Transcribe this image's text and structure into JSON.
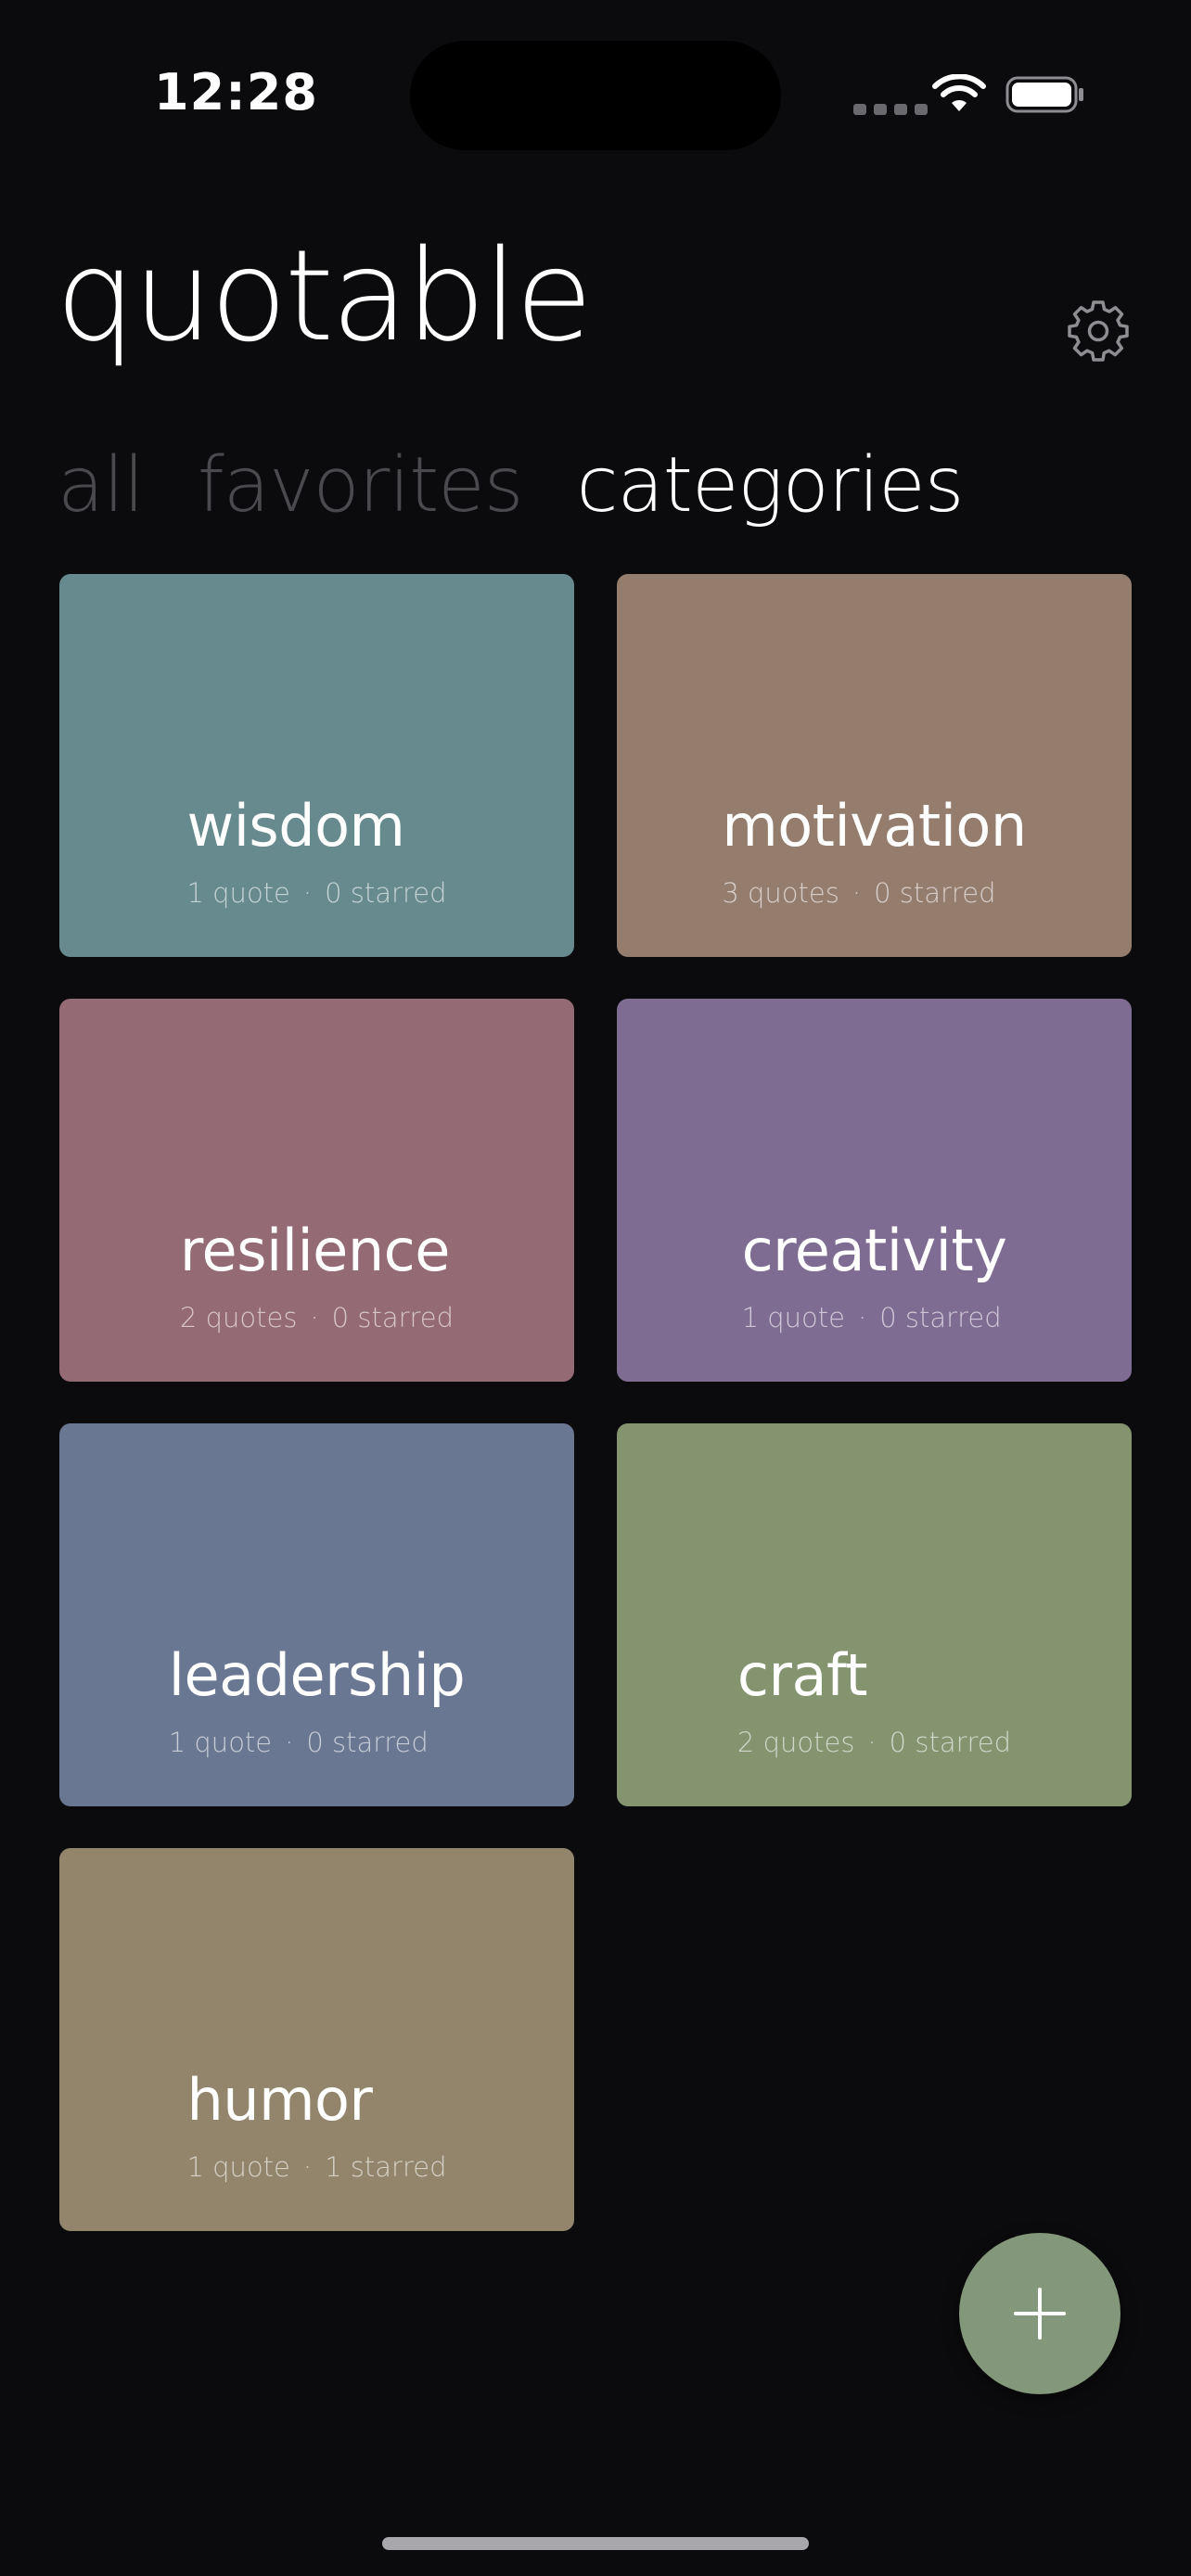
{
  "status_bar": {
    "time": "12:28"
  },
  "header": {
    "title": "quotable",
    "settings_icon": "gear-icon"
  },
  "tabs": [
    {
      "label": "all",
      "active": false
    },
    {
      "label": "favorites",
      "active": false
    },
    {
      "label": "categories",
      "active": true
    }
  ],
  "categories": [
    {
      "name": "wisdom",
      "quotes": "1 quote",
      "starred": "0 starred",
      "color": "#678a8e"
    },
    {
      "name": "motivation",
      "quotes": "3 quotes",
      "starred": "0 starred",
      "color": "#957d6e"
    },
    {
      "name": "resilience",
      "quotes": "2 quotes",
      "starred": "0 starred",
      "color": "#946a75"
    },
    {
      "name": "creativity",
      "quotes": "1 quote",
      "starred": "0 starred",
      "color": "#7f6c93"
    },
    {
      "name": "leadership",
      "quotes": "1 quote",
      "starred": "0 starred",
      "color": "#6a7792"
    },
    {
      "name": "craft",
      "quotes": "2 quotes",
      "starred": "0 starred",
      "color": "#83946f"
    },
    {
      "name": "humor",
      "quotes": "1 quote",
      "starred": "1 starred",
      "color": "#92856b"
    }
  ],
  "meta_separator": "·",
  "fab": {
    "icon": "plus-icon",
    "color": "#83977a"
  }
}
